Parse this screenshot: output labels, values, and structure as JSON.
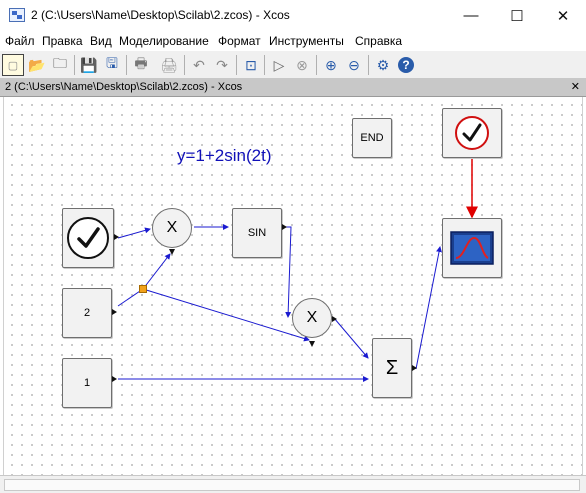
{
  "window": {
    "title": "2 (C:\\Users\\Name\\Desktop\\Scilab\\2.zcos) - Xcos",
    "minimize_label": "—",
    "maximize_label": "☐",
    "close_label": "✕"
  },
  "menu": {
    "items": [
      {
        "label": "Файл"
      },
      {
        "label": "Правка"
      },
      {
        "label": "Вид"
      },
      {
        "label": "Моделирование"
      },
      {
        "label": "Формат"
      },
      {
        "label": "Инструменты"
      },
      {
        "label": "Справка"
      }
    ]
  },
  "toolbar": {
    "buttons": [
      {
        "icon": "new-diagram-icon",
        "glyph": "▢"
      },
      {
        "icon": "open-folder-icon",
        "glyph": "📂"
      },
      {
        "icon": "open-recent-icon",
        "glyph": "🗀"
      },
      {
        "icon": "save-icon",
        "glyph": "💾"
      },
      {
        "icon": "save-as-icon",
        "glyph": "🖫"
      },
      {
        "icon": "print-icon",
        "glyph": "🖶"
      },
      {
        "icon": "print-disabled-icon",
        "glyph": "🖨"
      },
      {
        "icon": "undo-icon",
        "glyph": "↶"
      },
      {
        "icon": "redo-icon",
        "glyph": "↷"
      },
      {
        "icon": "fit-view-icon",
        "glyph": "⊡"
      },
      {
        "icon": "start-simulation-icon",
        "glyph": "▷"
      },
      {
        "icon": "stop-simulation-icon",
        "glyph": "⊗"
      },
      {
        "icon": "zoom-in-icon",
        "glyph": "⊕"
      },
      {
        "icon": "zoom-out-icon",
        "glyph": "⊖"
      },
      {
        "icon": "settings-icon",
        "glyph": "⚙"
      },
      {
        "icon": "help-icon",
        "glyph": "?"
      }
    ]
  },
  "document": {
    "tab_title": "2 (C:\\Users\\Name\\Desktop\\Scilab\\2.zcos) - Xcos",
    "close_label": "✕"
  },
  "diagram": {
    "formula": "y=1+2sin(2t)",
    "blocks": {
      "end": "END",
      "sin": "SIN",
      "const2": "2",
      "const1": "1",
      "product1": "X",
      "product2": "X",
      "sum": "Σ"
    },
    "colors": {
      "link": "#1a1ad0",
      "event_link": "#e00000",
      "formula": "#1010b8",
      "split": "#f2a21b"
    }
  }
}
